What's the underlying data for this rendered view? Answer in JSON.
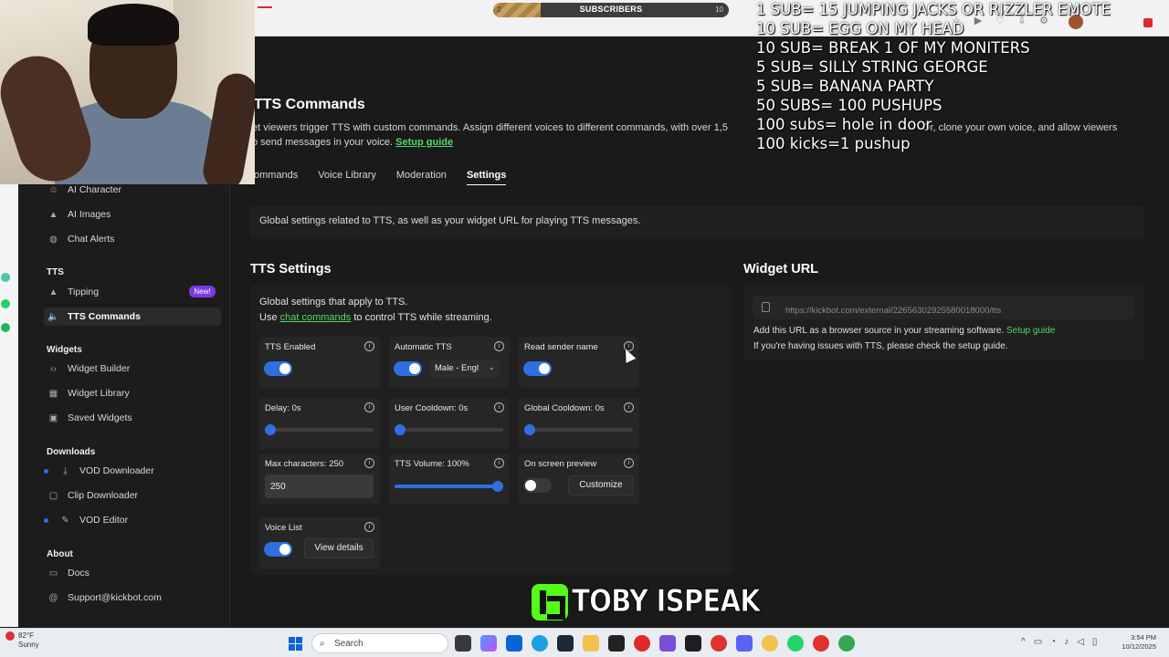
{
  "stream_overlay": {
    "sub_goal": {
      "label": "SUBSCRIBERS",
      "start": "2",
      "end": "10",
      "progress": 0.2
    },
    "goals": [
      "1 SUB= 15 JUMPING JACKS OR RIZZLER EMOTE",
      "10 SUB= EGG ON MY HEAD",
      "10 SUB= BREAK 1 OF MY MONITERS",
      "5 SUB= SILLY STRING GEORGE",
      "5 SUB= BANANA  PARTY",
      "50 SUBS= 100 PUSHUPS",
      "100 subs= hole in door",
      "100 kicks=1 pushup"
    ],
    "watermark": "TOBY ISPEAK"
  },
  "sidebar": {
    "items_top": [
      {
        "icon": "ai-character-icon",
        "label": "AI Character"
      },
      {
        "icon": "ai-images-icon",
        "label": "AI Images"
      },
      {
        "icon": "chat-alerts-icon",
        "label": "Chat Alerts"
      }
    ],
    "sections": {
      "tts": "TTS",
      "widgets": "Widgets",
      "downloads": "Downloads",
      "about": "About"
    },
    "tts_items": [
      {
        "icon": "tipping-icon",
        "label": "Tipping",
        "badge": "New!"
      },
      {
        "icon": "speaker-icon",
        "label": "TTS Commands"
      }
    ],
    "widgets_items": [
      {
        "icon": "code-icon",
        "label": "Widget Builder"
      },
      {
        "icon": "library-icon",
        "label": "Widget Library"
      },
      {
        "icon": "saved-icon",
        "label": "Saved Widgets"
      }
    ],
    "downloads_items": [
      {
        "icon": "download-icon",
        "label": "VOD Downloader"
      },
      {
        "icon": "clip-icon",
        "label": "Clip Downloader"
      },
      {
        "icon": "edit-icon",
        "label": "VOD Editor"
      }
    ],
    "about_items": [
      {
        "icon": "docs-icon",
        "label": "Docs"
      },
      {
        "icon": "at-icon",
        "label": "Support@kickbot.com"
      }
    ]
  },
  "page": {
    "title": "TTS Commands",
    "desc_line1": "et viewers trigger TTS with custom commands. Assign different voices to different commands, with over 1,5",
    "desc_line1b": "Or, clone your own voice, and allow viewers",
    "desc_line2": "o send messages in your voice.",
    "desc_link": "Setup guide",
    "tabs": [
      "ommands",
      "Voice Library",
      "Moderation",
      "Settings"
    ],
    "active_tab": "Settings",
    "banner": "Global settings related to TTS, as well as your widget URL for playing TTS messages."
  },
  "tts_settings": {
    "title": "TTS Settings",
    "intro_line1": "Global settings that apply to TTS.",
    "intro_use": "Use",
    "intro_link": "chat commands",
    "intro_rest": "to control TTS while streaming.",
    "tts_enabled": {
      "label": "TTS Enabled",
      "on": true
    },
    "automatic_tts": {
      "label": "Automatic TTS",
      "on": true,
      "voice": "Male - Engl"
    },
    "read_sender": {
      "label": "Read sender name",
      "on": true
    },
    "delay": {
      "label": "Delay: 0s",
      "value": 0
    },
    "user_cooldown": {
      "label": "User Cooldown: 0s",
      "value": 0
    },
    "global_cooldown": {
      "label": "Global Cooldown: 0s",
      "value": 0
    },
    "max_chars": {
      "label": "Max characters: 250",
      "value": "250"
    },
    "volume": {
      "label": "TTS Volume: 100%",
      "value": 1.0
    },
    "preview": {
      "label": "On screen preview",
      "on": false,
      "button": "Customize"
    },
    "voice_list": {
      "label": "Voice List",
      "on": true,
      "button": "View details"
    }
  },
  "widget": {
    "title": "Widget URL",
    "url": "https://kickbot.com/external/2265630292558001800​0/tts",
    "note_line1": "Add this URL as a browser source in your streaming software.",
    "note_link": "Setup guide",
    "note_line2": "If you're having issues with TTS, please check the setup guide."
  },
  "taskbar": {
    "temp": "82°F",
    "weather": "Sunny",
    "search_placeholder": "Search",
    "time": "3:54 PM",
    "date": "10/12/2025"
  },
  "colors": {
    "accent": "#2f6fe0",
    "link": "#53d768",
    "badge": "#7a3be0",
    "kick_green": "#53fc18"
  }
}
